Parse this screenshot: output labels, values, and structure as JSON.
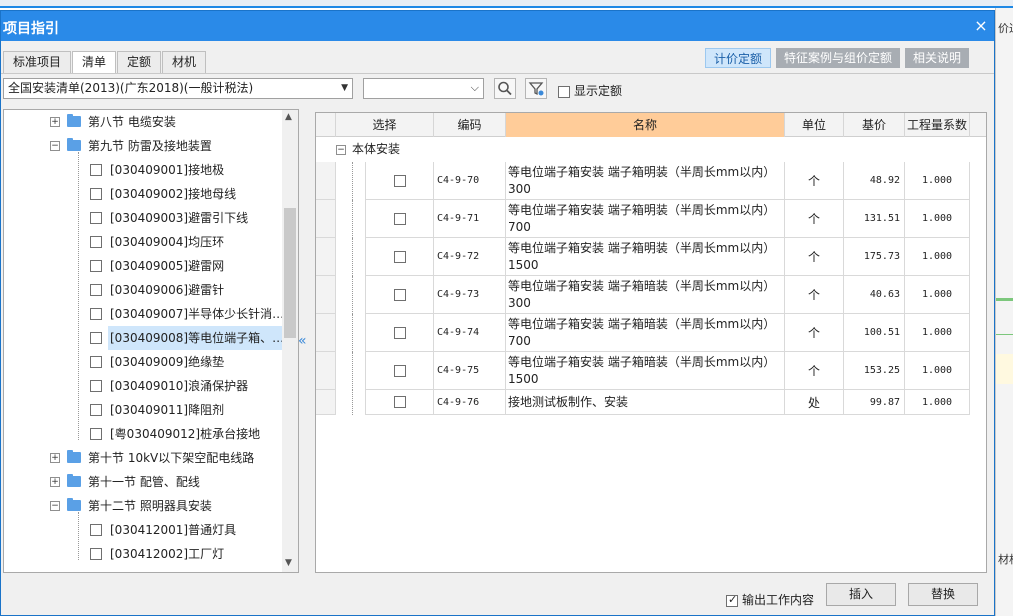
{
  "background": {
    "fragment_top": "价过",
    "fragment_bottom": "材机"
  },
  "dialog": {
    "title": "项目指引",
    "close_glyph": "×"
  },
  "tabs": [
    {
      "label": "标准项目",
      "active": false
    },
    {
      "label": "清单",
      "active": true
    },
    {
      "label": "定额",
      "active": false
    },
    {
      "label": "材机",
      "active": false
    }
  ],
  "right_buttons": [
    {
      "label": "计价定额",
      "active": true
    },
    {
      "label": "特征案例与组价定额",
      "active": false
    },
    {
      "label": "相关说明",
      "active": false
    }
  ],
  "toolbar": {
    "library_select": "全国安装清单(2013)(广东2018)(一般计税法)",
    "filter_combo": "",
    "search_icon": "search-icon",
    "filter_icon": "filter-icon",
    "show_quota_label": "显示定额",
    "show_quota_checked": false
  },
  "tree": [
    {
      "kind": "section",
      "expander": "+",
      "label": "第八节  电缆安装"
    },
    {
      "kind": "section",
      "expander": "−",
      "label": "第九节  防雷及接地装置"
    },
    {
      "kind": "item",
      "label": "[030409001]接地极"
    },
    {
      "kind": "item",
      "label": "[030409002]接地母线"
    },
    {
      "kind": "item",
      "label": "[030409003]避雷引下线"
    },
    {
      "kind": "item",
      "label": "[030409004]均压环"
    },
    {
      "kind": "item",
      "label": "[030409005]避雷网"
    },
    {
      "kind": "item",
      "label": "[030409006]避雷针"
    },
    {
      "kind": "item",
      "label": "[030409007]半导体少长针消…"
    },
    {
      "kind": "item",
      "label": "[030409008]等电位端子箱、…",
      "selected": true
    },
    {
      "kind": "item",
      "label": "[030409009]绝缘垫"
    },
    {
      "kind": "item",
      "label": "[030409010]浪涌保护器"
    },
    {
      "kind": "item",
      "label": "[030409011]降阻剂"
    },
    {
      "kind": "item",
      "label": "[粤030409012]桩承台接地"
    },
    {
      "kind": "section",
      "expander": "+",
      "label": "第十节  10kV以下架空配电线路"
    },
    {
      "kind": "section",
      "expander": "+",
      "label": "第十一节  配管、配线"
    },
    {
      "kind": "section",
      "expander": "−",
      "label": "第十二节  照明器具安装"
    },
    {
      "kind": "item",
      "label": "[030412001]普通灯具"
    },
    {
      "kind": "item",
      "label": "[030412002]工厂灯"
    }
  ],
  "grid": {
    "headers": [
      "选择",
      "编码",
      "名称",
      "单位",
      "基价",
      "工程量系数"
    ],
    "group_expander": "−",
    "group_label": "本体安装",
    "rows": [
      {
        "code": "C4-9-70",
        "name": "等电位端子箱安装 端子箱明装（半周长mm以内） 300",
        "unit": "个",
        "price": "48.92",
        "coef": "1.000"
      },
      {
        "code": "C4-9-71",
        "name": "等电位端子箱安装 端子箱明装（半周长mm以内） 700",
        "unit": "个",
        "price": "131.51",
        "coef": "1.000"
      },
      {
        "code": "C4-9-72",
        "name": "等电位端子箱安装 端子箱明装（半周长mm以内） 1500",
        "unit": "个",
        "price": "175.73",
        "coef": "1.000"
      },
      {
        "code": "C4-9-73",
        "name": "等电位端子箱安装 端子箱暗装（半周长mm以内） 300",
        "unit": "个",
        "price": "40.63",
        "coef": "1.000"
      },
      {
        "code": "C4-9-74",
        "name": "等电位端子箱安装 端子箱暗装（半周长mm以内） 700",
        "unit": "个",
        "price": "100.51",
        "coef": "1.000"
      },
      {
        "code": "C4-9-75",
        "name": "等电位端子箱安装 端子箱暗装（半周长mm以内） 1500",
        "unit": "个",
        "price": "153.25",
        "coef": "1.000"
      },
      {
        "code": "C4-9-76",
        "name": "接地测试板制作、安装",
        "unit": "处",
        "price": "99.87",
        "coef": "1.000"
      }
    ]
  },
  "bottom": {
    "output_label": "输出工作内容",
    "output_checked": true,
    "insert_label": "插入",
    "replace_label": "替换"
  }
}
